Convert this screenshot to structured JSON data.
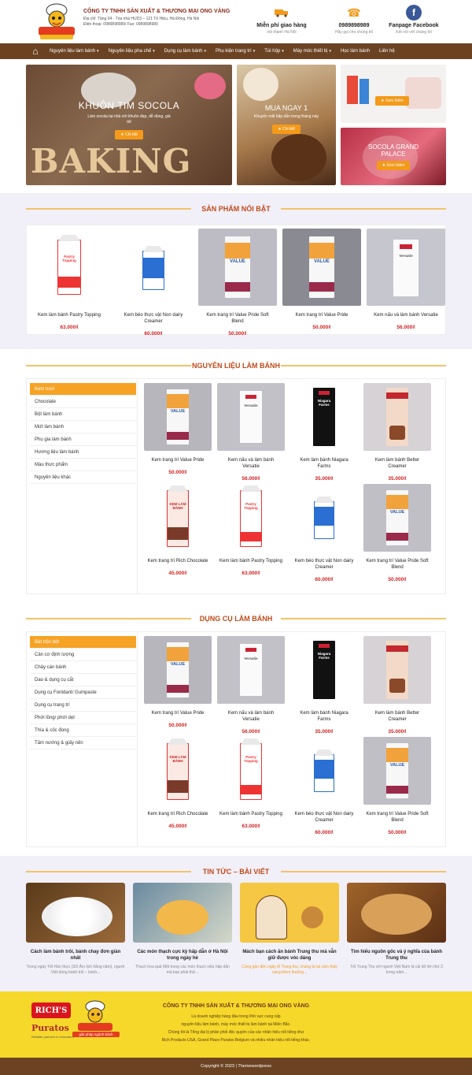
{
  "header": {
    "company_name": "CÔNG TY TNHH SẢN XUẤT & THƯƠNG MẠI ONG VÀNG",
    "address": "Địa chỉ: Tầng 04 - Tòa nhà HUD3 – 121 Tô Hiệu, Hà Đông, Hà Nội",
    "phone_fax": "Điện thoại: 0989898989/ Fax: 0989898989",
    "boxes": [
      {
        "title": "Miễn phí giao hàng",
        "sub": "nội thành Hà Nội",
        "icon": "truck-icon"
      },
      {
        "title": "0989898989",
        "sub": "Hãy gọi cho chúng tôi",
        "icon": "phone-icon"
      },
      {
        "title": "Fanpage Facebook",
        "sub": "Kết nối với chúng tôi",
        "icon": "facebook-icon"
      }
    ],
    "colors": {
      "brand_brown": "#6b4323",
      "accent_orange": "#f39a1a",
      "price_red": "#cf1f1f"
    }
  },
  "nav": {
    "items": [
      "Nguyên liệu làm bánh",
      "Nguyên liệu pha chế",
      "Dụng cụ làm bánh",
      "Phụ kiện trang trí",
      "Túi hộp",
      "Máy móc thiết bị",
      "Học làm bánh",
      "Liên hệ"
    ]
  },
  "slider": {
    "main_title": "KHUÔN TIM SOCOLA",
    "main_text": "Làm socola tại nhà với khuôn đẹp, dễ dùng, giá tốt",
    "main_button": "Chi tiết",
    "baking_text": "BAKING",
    "mid_title": "MUA NGAY 1",
    "mid_text": "Khuyến mãi hấp dẫn trong tháng này",
    "mid_button": "Chi tiết",
    "side1_button": "Xem thêm",
    "side2_title": "SOCOLA GRAND PALACE",
    "side2_button": "Xem thêm"
  },
  "featured": {
    "title": "SẢN PHẨM NỔI BẬT",
    "items": [
      {
        "name": "Kem làm bánh Pastry Topping",
        "price": "63.000₫"
      },
      {
        "name": "Kem béo thực vật Non dairy Creamer",
        "price": "60.000₫"
      },
      {
        "name": "Kem trang trí Value Pride Soft Blend",
        "price": "50.000₫"
      },
      {
        "name": "Kem trang trí Value Pride",
        "price": "50.000₫"
      },
      {
        "name": "Kem nấu và làm bánh Versatie",
        "price": "56.000₫"
      }
    ]
  },
  "ingredients": {
    "title": "NGUYÊN LIỆU LÀM BÁNH",
    "categories": [
      "Kem tươi",
      "Chocolate",
      "Bột làm bánh",
      "Mứt làm bánh",
      "Phụ gia làm bánh",
      "Hương liệu làm bánh",
      "Màu thực phẩm",
      "Nguyên liệu khác"
    ],
    "items": [
      {
        "name": "Kem trang trí Value Pride",
        "price": "50.000₫"
      },
      {
        "name": "Kem nấu và làm bánh Versatie",
        "price": "56.000₫"
      },
      {
        "name": "Kem làm bánh Niagara Farms",
        "price": "35.000₫"
      },
      {
        "name": "Kem làm bánh Better Creamer",
        "price": "35.000₫"
      },
      {
        "name": "Kem trang trí Rich Chocolate",
        "price": "45.000₫"
      },
      {
        "name": "Kem làm bánh Pastry Topping",
        "price": "63.000₫"
      },
      {
        "name": "Kem béo thực vật Non dairy Creamer",
        "price": "60.000₫"
      },
      {
        "name": "Kem trang trí Value Pride Soft Blend",
        "price": "50.000₫"
      }
    ]
  },
  "tools": {
    "title": "DỤNG CỤ LÀM BÁNH",
    "categories": [
      "Bát trộn bột",
      "Cân cơ định lượng",
      "Chảy cán bánh",
      "Dao & dụng cụ cắt",
      "Dụng cụ Fontdant/ Gumpaste",
      "Dụng cụ trang trí",
      "Phới lồng/ phới dẹt",
      "Thìa & cốc đong",
      "Tấm nướng & giấy nến"
    ],
    "items": [
      {
        "name": "Kem trang trí Value Pride",
        "price": "50.000₫"
      },
      {
        "name": "Kem nấu và làm bánh Versatie",
        "price": "56.000₫"
      },
      {
        "name": "Kem làm bánh Niagara Farms",
        "price": "35.000₫"
      },
      {
        "name": "Kem làm bánh Better Creamer",
        "price": "35.000₫"
      },
      {
        "name": "Kem trang trí Rich Chocolate",
        "price": "45.000₫"
      },
      {
        "name": "Kem làm bánh Pastry Topping",
        "price": "63.000₫"
      },
      {
        "name": "Kem béo thực vật Non dairy Creamer",
        "price": "60.000₫"
      },
      {
        "name": "Kem trang trí Value Pride Soft Blend",
        "price": "50.000₫"
      }
    ]
  },
  "news": {
    "title": "TIN TỨC – BÀI VIẾT",
    "items": [
      {
        "title": "Cách làm bánh trôi, bánh chay đơn giản nhất",
        "excerpt": "Trong ngày Tết Hàn thực (3/3 Âm lịch hằng năm), người Việt dùng bánh trôi – bánh..."
      },
      {
        "title": "Các món thạch cực kỳ hấp dẫn ở Hà Nội trong ngày hè",
        "excerpt": "Thạch hoa quả Một trong các món thạch siêu hấp dẫn mà bạn phải thử..."
      },
      {
        "title": "Mách bạn cách ăn bánh Trung thu mà vẫn giữ được vóc dáng",
        "excerpt": "Cùng gần đến ngày lễ Trung thu, chúng ta lại cảm thấy càng thèm thuồng..."
      },
      {
        "title": "Tìm hiểu nguồn gốc và ý nghĩa của bánh Trung thu",
        "excerpt": "Tết Trung Thu với người Việt Nam là cái tết lớn thứ 3 trong năm..."
      }
    ]
  },
  "footer": {
    "company_name": "CÔNG TY TNHH SẢN XUẤT & THƯƠNG MẠI ONG VÀNG",
    "lines": [
      "Là doanh nghiệp hàng đầu trong lĩnh vực cung cấp",
      "nguyên liệu làm bánh, máy móc thiết bị làm bánh tại Miền Bắc.",
      "Chúng tôi là Tổng đại lý phân phối độc quyền của các nhãn hiệu nổi tiếng như",
      "Rich Products USA, Grand Place Puratos Belgium và nhiều nhãn hiệu nổi tiếng khác."
    ],
    "brand1": "RICH'S",
    "brand2": "Puratos",
    "brand2_sub": "Reliable partners in innovation",
    "logo_sub": "giải pháp ngành bánh",
    "copyright": "Copyright © 2023 | Themewordpress"
  }
}
